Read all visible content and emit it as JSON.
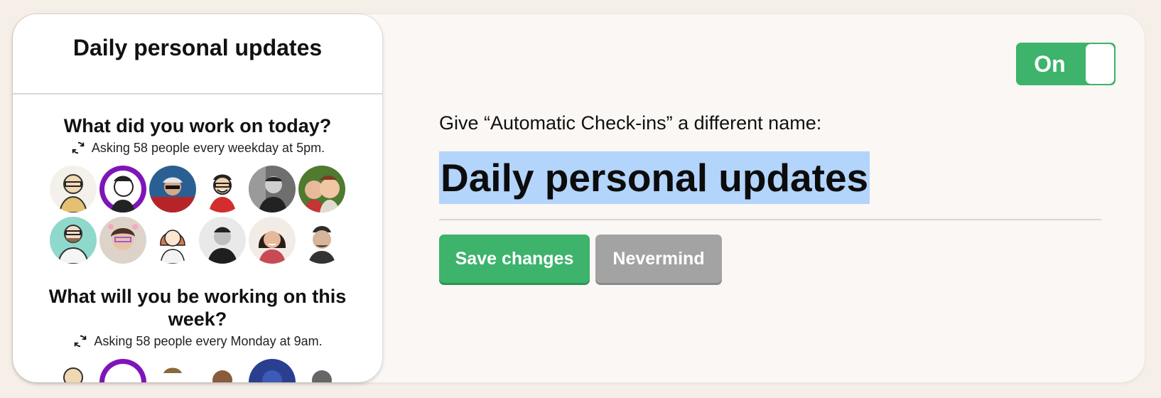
{
  "preview": {
    "title": "Daily personal updates",
    "questions": [
      {
        "title": "What did you work on today?",
        "schedule": "Asking 58 people every weekday at 5pm.",
        "avatars": [
          "avatar-1",
          "avatar-2",
          "avatar-3",
          "avatar-4",
          "avatar-5",
          "avatar-6",
          "avatar-7",
          "avatar-8",
          "avatar-9",
          "avatar-10",
          "avatar-11",
          "avatar-12"
        ]
      },
      {
        "title": "What will you be working on this week?",
        "schedule": "Asking 58 people every Monday at 9am."
      }
    ]
  },
  "toggle": {
    "label": "On",
    "state": "on"
  },
  "rename": {
    "label": "Give “Automatic Check-ins” a different name:",
    "value": "Daily personal updates"
  },
  "actions": {
    "save_label": "Save changes",
    "cancel_label": "Nevermind"
  },
  "colors": {
    "accent_green": "#3db36b",
    "muted_gray": "#a3a3a3",
    "selection_blue": "#b3d4fb",
    "background": "#f5efe7"
  }
}
